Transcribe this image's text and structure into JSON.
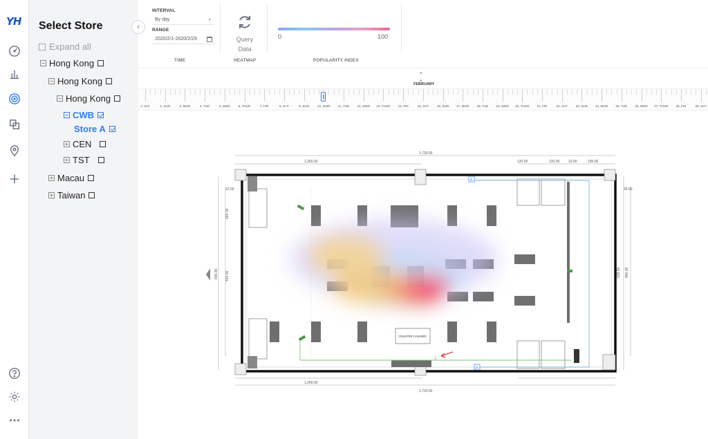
{
  "app": {
    "logo": "YH"
  },
  "sidebar": {
    "title": "Select Store",
    "expand_all": "Expand all",
    "tree": [
      {
        "label": "Hong Kong",
        "toggle": "−",
        "checked": false
      },
      {
        "label": "Hong Kong",
        "toggle": "−",
        "checked": false
      },
      {
        "label": "Hong Kong",
        "toggle": "−",
        "checked": false
      },
      {
        "label": "CWB",
        "toggle": "−",
        "checked": true,
        "selected": true
      },
      {
        "label": "Store A",
        "checked": true,
        "selected": true
      },
      {
        "label": "CEN",
        "toggle": "+",
        "checked": false
      },
      {
        "label": "TST",
        "toggle": "+",
        "checked": false
      },
      {
        "label": "Macau",
        "toggle": "+",
        "checked": false
      },
      {
        "label": "Taiwan",
        "toggle": "+",
        "checked": false
      }
    ]
  },
  "toolbar": {
    "interval_label": "INTERVAL",
    "interval_value": "By day",
    "range_label": "RANGE",
    "range_value": "2020/2/1-2020/2/29",
    "query_label_1": "Query",
    "query_label_2": "Data",
    "scale_min": "0",
    "scale_max": "100",
    "col_time": "TIME",
    "col_heatmap": "HEATMAP",
    "col_popularity": "POPULARITY INDEX"
  },
  "timeline": {
    "month": "FEBRUARY",
    "days": [
      "1, SAT",
      "2, SUN",
      "3, MON",
      "4, TUE",
      "5, WED",
      "6, THUR",
      "7, FRI",
      "8, SAT",
      "9, SUN",
      "10, MON",
      "11, TUE",
      "12, WED",
      "13, THUR",
      "14, FRI",
      "15, SAT",
      "16, SUN",
      "17, MON",
      "18, TUE",
      "19, WED",
      "20, THUR",
      "21, FRI",
      "22, SAT",
      "23, SUN",
      "24, MON",
      "25, TUE",
      "26, WED",
      "27, THUR",
      "28, FRI",
      "29, SAT"
    ],
    "selected_day": 10
  },
  "floorplan": {
    "dim_top": "1,720.00",
    "dim_bottom": "1,720.00",
    "dim_top_left": "1,260.00",
    "dim_bottom_left": "1,260.00",
    "dim_120a": "120.00",
    "dim_120b": "120.00",
    "dim_10a": "10.00",
    "dim_195": "195.00",
    "dim_left": "800.00",
    "dim_left_small": "10.00",
    "dim_left_mid": "165.15",
    "dim_left_mid2": "422.00",
    "dim_right": "800.00",
    "dim_right_mid": "629.50",
    "dim_right_small": "35.00",
    "counter_label": "COUNTER CASHIER",
    "camera_a": "A",
    "camera_b": "A"
  },
  "colors": {
    "accent": "#2f7ff0",
    "rail_icon": "#6b7280",
    "panel_bg": "#f3f4f6"
  }
}
